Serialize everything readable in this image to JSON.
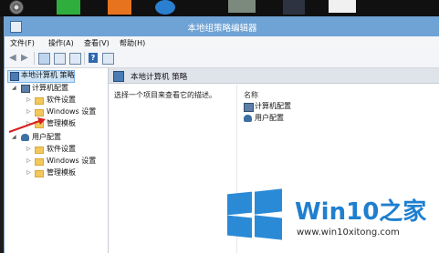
{
  "window": {
    "title": "本地组策略编辑器"
  },
  "menu": [
    {
      "label": "文件(F)"
    },
    {
      "label": "操作(A)"
    },
    {
      "label": "查看(V)"
    },
    {
      "label": "帮助(H)"
    }
  ],
  "tree": {
    "root": "本地计算机 策略",
    "computer": {
      "label": "计算机配置",
      "children": [
        "软件设置",
        "Windows 设置",
        "管理模板"
      ]
    },
    "user": {
      "label": "用户配置",
      "children": [
        "软件设置",
        "Windows 设置",
        "管理模板"
      ]
    }
  },
  "right": {
    "header": "本地计算机 策略",
    "description": "选择一个项目来查看它的描述。",
    "column_name": "名称",
    "items": [
      "计算机配置",
      "用户配置"
    ]
  },
  "watermark": {
    "brand": "Win10",
    "brand_suffix": "之家",
    "url": "www.win10xitong.com"
  },
  "colors": {
    "titlebar": "#6fa3d6",
    "selection": "#cde5f9",
    "annotation_arrow": "#d81e1e",
    "watermark": "#1f7fcf"
  },
  "icons": [
    "back-arrow-icon",
    "forward-arrow-icon",
    "tree-view-icon",
    "properties-icon",
    "export-icon",
    "help-icon",
    "filter-icon"
  ]
}
